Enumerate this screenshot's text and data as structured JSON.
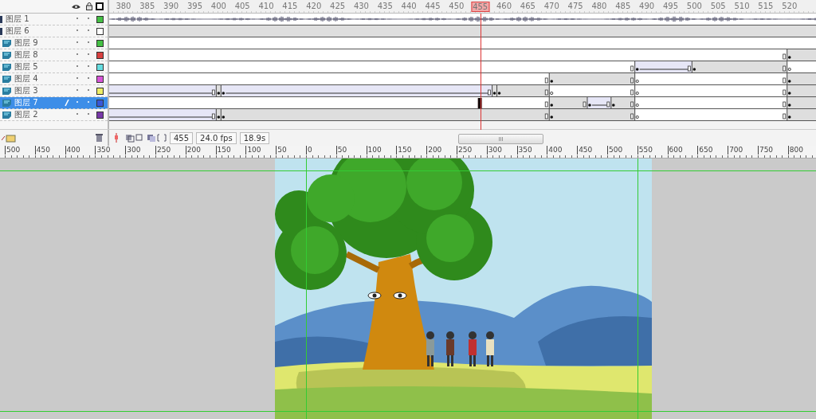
{
  "timeline": {
    "frame_labels": [
      {
        "label": "380",
        "selected": false
      },
      {
        "label": "385",
        "selected": false
      },
      {
        "label": "390",
        "selected": false
      },
      {
        "label": "395",
        "selected": false
      },
      {
        "label": "400",
        "selected": false
      },
      {
        "label": "405",
        "selected": false
      },
      {
        "label": "410",
        "selected": false
      },
      {
        "label": "415",
        "selected": false
      },
      {
        "label": "420",
        "selected": false
      },
      {
        "label": "425",
        "selected": false
      },
      {
        "label": "430",
        "selected": false
      },
      {
        "label": "435",
        "selected": false
      },
      {
        "label": "440",
        "selected": false
      },
      {
        "label": "445",
        "selected": false
      },
      {
        "label": "450",
        "selected": false
      },
      {
        "label": "455",
        "selected": true
      },
      {
        "label": "460",
        "selected": false
      },
      {
        "label": "465",
        "selected": false
      },
      {
        "label": "470",
        "selected": false
      },
      {
        "label": "475",
        "selected": false
      },
      {
        "label": "480",
        "selected": false
      },
      {
        "label": "485",
        "selected": false
      },
      {
        "label": "490",
        "selected": false
      },
      {
        "label": "495",
        "selected": false
      },
      {
        "label": "500",
        "selected": false
      },
      {
        "label": "505",
        "selected": false
      },
      {
        "label": "510",
        "selected": false
      },
      {
        "label": "515",
        "selected": false
      },
      {
        "label": "520",
        "selected": false
      }
    ],
    "layers": [
      {
        "name": "图层 1",
        "kind": "sound",
        "color": "#44c044",
        "selected": false
      },
      {
        "name": "图层 6",
        "kind": "guide",
        "color": "#ffffff",
        "selected": false,
        "children": [
          {
            "name": "图层 9",
            "kind": "normal",
            "color": "#44c044",
            "selected": false
          },
          {
            "name": "图层 8",
            "kind": "normal",
            "color": "#d84040",
            "selected": false
          },
          {
            "name": "图层 5",
            "kind": "normal",
            "color": "#66dde0",
            "selected": false
          },
          {
            "name": "图层 4",
            "kind": "normal",
            "color": "#d855d8",
            "selected": false
          },
          {
            "name": "图层 3",
            "kind": "normal",
            "color": "#eeee66",
            "selected": false
          },
          {
            "name": "图层 7",
            "kind": "normal",
            "color": "#3858d8",
            "selected": true
          },
          {
            "name": "图层 2",
            "kind": "normal",
            "color": "#7838a8",
            "selected": false
          }
        ]
      }
    ],
    "status": {
      "frame": "455",
      "fps": "24.0 fps",
      "time": "18.9s",
      "scroll_grip": "III"
    }
  },
  "ruler": [
    "500",
    "450",
    "400",
    "350",
    "300",
    "250",
    "200",
    "150",
    "100",
    "50",
    "0",
    "50",
    "100",
    "150",
    "200",
    "250",
    "300",
    "350",
    "400",
    "450",
    "500",
    "550",
    "600",
    "650",
    "700",
    "750",
    "800"
  ]
}
